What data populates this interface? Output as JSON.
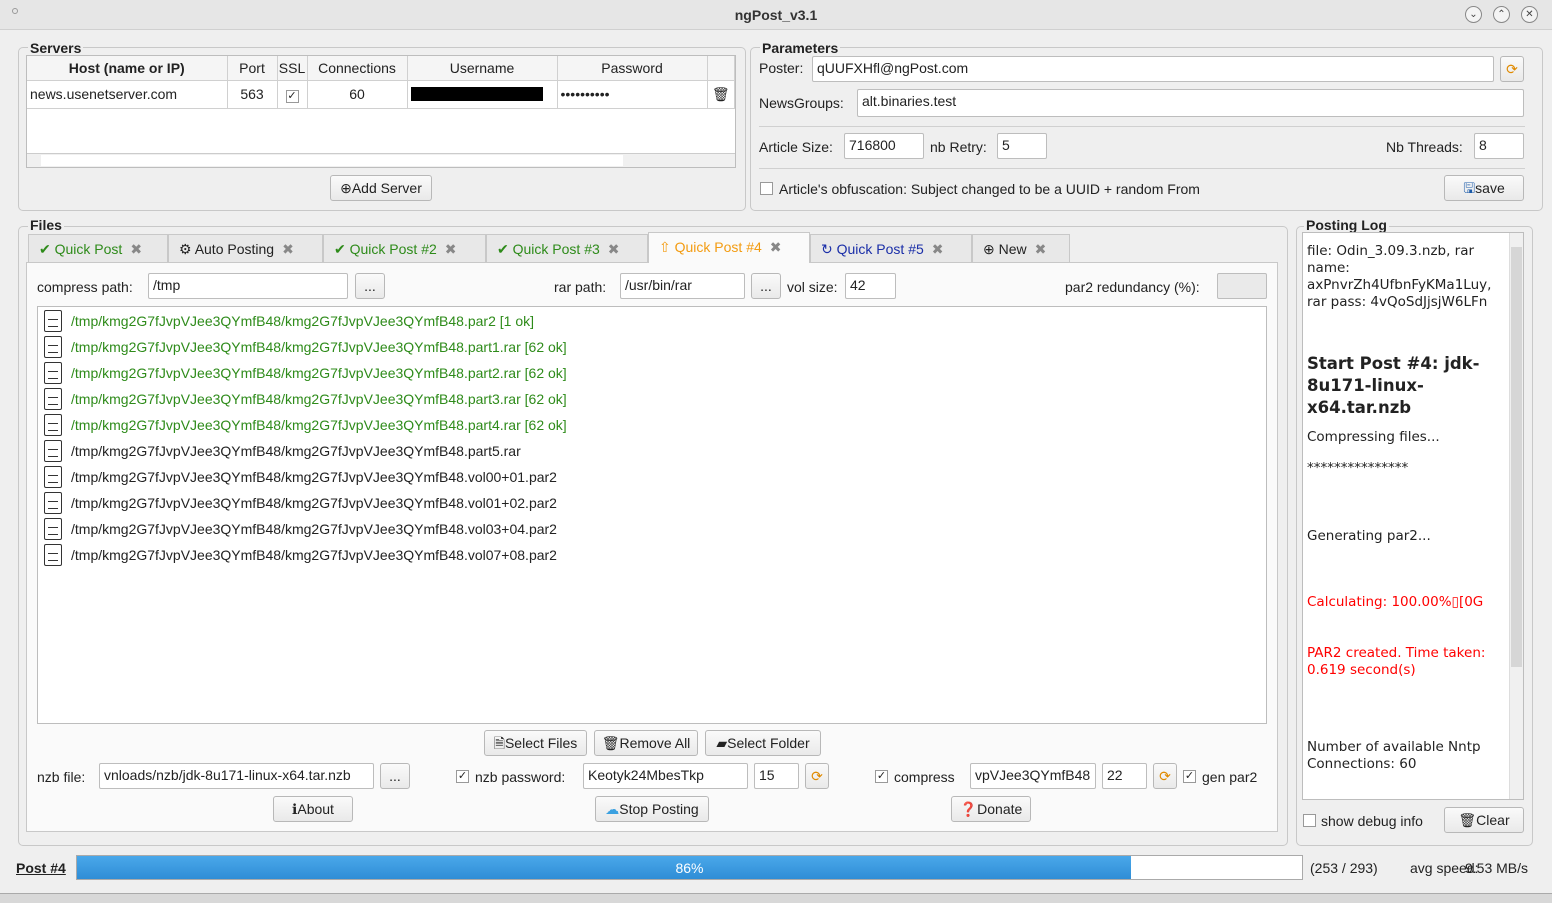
{
  "window": {
    "title": "ngPost_v3.1"
  },
  "servers": {
    "label": "Servers",
    "columns": [
      "Host (name or IP)",
      "Port",
      "SSL",
      "Connections",
      "Username",
      "Password"
    ],
    "rows": [
      {
        "host": "news.usenetserver.com",
        "port": "563",
        "ssl": true,
        "connections": "60",
        "username": "",
        "password": "••••••••••"
      }
    ],
    "add_server": "Add Server"
  },
  "params": {
    "label": "Parameters",
    "poster_label": "Poster:",
    "poster": "qUUFXHfl@ngPost.com",
    "newsgroups_label": "NewsGroups:",
    "newsgroups": "alt.binaries.test",
    "article_size_label": "Article Size:",
    "article_size": "716800",
    "nb_retry_label": "nb Retry:",
    "nb_retry": "5",
    "nb_threads_label": "Nb Threads:",
    "nb_threads": "8",
    "obfuscation_label": "Article's obfuscation: Subject changed to be a UUID + random From",
    "obfuscation": false,
    "save": "save"
  },
  "files": {
    "label": "Files",
    "tabs": [
      {
        "label": "Quick Post",
        "color": "#2e8b1a",
        "icon": "check-circle-icon"
      },
      {
        "label": "Auto Posting",
        "color": "#222222",
        "icon": "gear-icon"
      },
      {
        "label": "Quick Post #2",
        "color": "#2e8b1a",
        "icon": "check-circle-icon"
      },
      {
        "label": "Quick Post #3",
        "color": "#2e8b1a",
        "icon": "check-circle-icon"
      },
      {
        "label": "Quick Post #4",
        "color": "#f39c12",
        "icon": "upload-icon",
        "active": true
      },
      {
        "label": "Quick Post #5",
        "color": "#1a2ea8",
        "icon": "refresh-icon"
      },
      {
        "label": "New",
        "color": "#222222",
        "icon": "plus-circle-icon"
      }
    ],
    "compress_path_label": "compress path:",
    "compress_path": "/tmp",
    "browse": "...",
    "rar_path_label": "rar path:",
    "rar_path": "/usr/bin/rar",
    "vol_size_label": "vol size:",
    "vol_size": "42",
    "par2_label": "par2 redundancy (%):",
    "par2": "",
    "list": [
      {
        "name": "/tmp/kmg2G7fJvpVJee3QYmfB48/kmg2G7fJvpVJee3QYmfB48.par2 [1 ok]",
        "done": true
      },
      {
        "name": "/tmp/kmg2G7fJvpVJee3QYmfB48/kmg2G7fJvpVJee3QYmfB48.part1.rar [62 ok]",
        "done": true
      },
      {
        "name": "/tmp/kmg2G7fJvpVJee3QYmfB48/kmg2G7fJvpVJee3QYmfB48.part2.rar [62 ok]",
        "done": true
      },
      {
        "name": "/tmp/kmg2G7fJvpVJee3QYmfB48/kmg2G7fJvpVJee3QYmfB48.part3.rar [62 ok]",
        "done": true
      },
      {
        "name": "/tmp/kmg2G7fJvpVJee3QYmfB48/kmg2G7fJvpVJee3QYmfB48.part4.rar [62 ok]",
        "done": true
      },
      {
        "name": "/tmp/kmg2G7fJvpVJee3QYmfB48/kmg2G7fJvpVJee3QYmfB48.part5.rar",
        "done": false
      },
      {
        "name": "/tmp/kmg2G7fJvpVJee3QYmfB48/kmg2G7fJvpVJee3QYmfB48.vol00+01.par2",
        "done": false
      },
      {
        "name": "/tmp/kmg2G7fJvpVJee3QYmfB48/kmg2G7fJvpVJee3QYmfB48.vol01+02.par2",
        "done": false
      },
      {
        "name": "/tmp/kmg2G7fJvpVJee3QYmfB48/kmg2G7fJvpVJee3QYmfB48.vol03+04.par2",
        "done": false
      },
      {
        "name": "/tmp/kmg2G7fJvpVJee3QYmfB48/kmg2G7fJvpVJee3QYmfB48.vol07+08.par2",
        "done": false
      }
    ],
    "select_files": "Select Files",
    "remove_all": "Remove All",
    "select_folder": "Select Folder",
    "nzb_file_label": "nzb file:",
    "nzb_file": "vnloads/nzb/jdk-8u171-linux-x64.tar.nzb",
    "nzb_password_label": "nzb password:",
    "nzb_password_checked": true,
    "nzb_password": "Keotyk24MbesTkp",
    "pass_len": "15",
    "compress_label": "compress",
    "compress_checked": true,
    "rar_name": "vpVJee3QYmfB48",
    "rar_len": "22",
    "gen_par2_label": "gen par2",
    "gen_par2_checked": true,
    "about": "About",
    "stop_posting": "Stop Posting",
    "donate": "Donate"
  },
  "log": {
    "label": "Posting Log",
    "l1": "file: Odin_3.09.3.nzb, rar name: axPnvrZh4UfbnFyKMa1Luy, rar pass: 4vQoSdJjsjW6LFn",
    "l2": "Start Post #4: jdk-8u171-linux-x64.tar.nzb",
    "l3": "Compressing files...",
    "l4": "***************",
    "l5": "Generating par2...",
    "l6": "Calculating: 100.00%▯[0G",
    "l7": "PAR2 created. Time taken: 0.619 second(s)",
    "l8": "Number of available Nntp Connections: 60",
    "show_debug": "show debug info",
    "clear": "Clear",
    "error_color": "#ff0000"
  },
  "status": {
    "post_label": "Post #4",
    "progress_percent": 86,
    "progress_text": "86%",
    "counts": "(253 / 293)",
    "speed_label": "avg speed:",
    "speed": "9.53 MB/s"
  }
}
